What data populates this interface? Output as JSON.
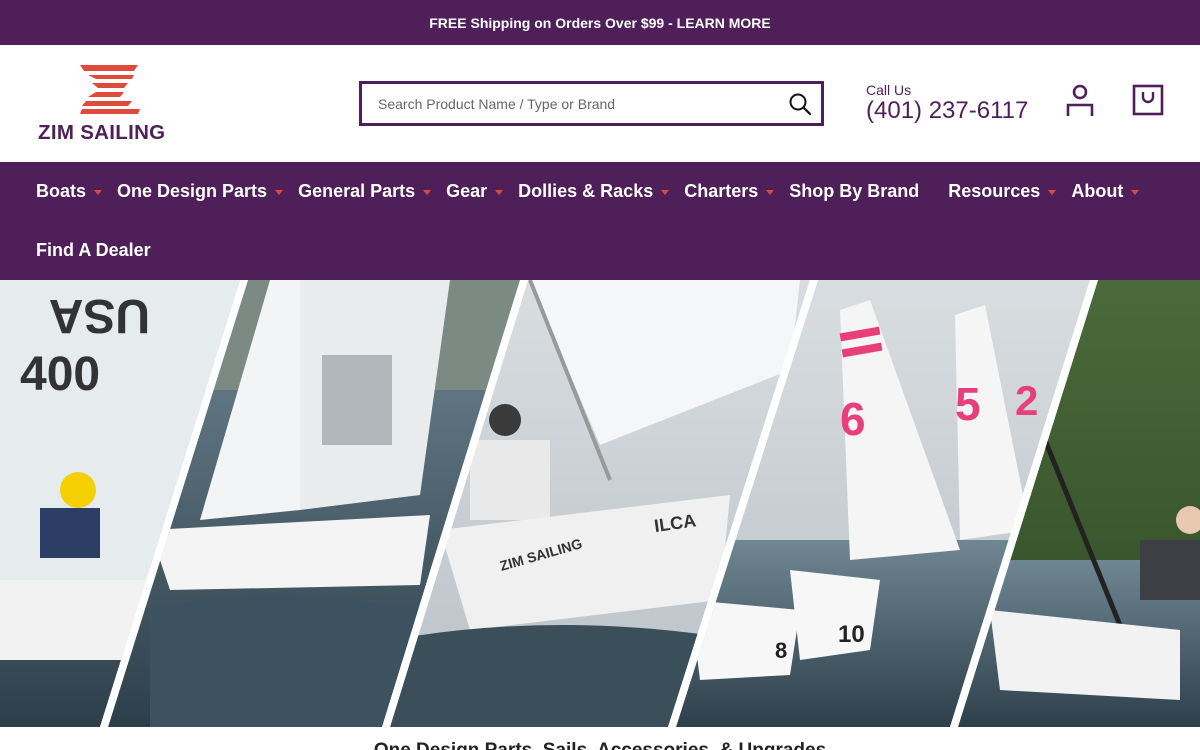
{
  "promo": {
    "text": "FREE Shipping on Orders Over $99 - LEARN MORE"
  },
  "header": {
    "logo_text": "ZIM SAILING",
    "search": {
      "placeholder": "Search Product Name / Type or Brand",
      "value": ""
    },
    "call_label": "Call Us",
    "phone": "(401) 237-6117"
  },
  "nav": {
    "row1": [
      {
        "label": "Boats",
        "has_dropdown": true
      },
      {
        "label": "One Design Parts",
        "has_dropdown": true
      },
      {
        "label": "General Parts",
        "has_dropdown": true
      },
      {
        "label": "Gear",
        "has_dropdown": true
      },
      {
        "label": "Dollies & Racks",
        "has_dropdown": true
      },
      {
        "label": "Charters",
        "has_dropdown": true
      },
      {
        "label": "Shop By Brand",
        "has_dropdown": false
      },
      {
        "label": "Resources",
        "has_dropdown": true
      },
      {
        "label": "About",
        "has_dropdown": true
      }
    ],
    "row2": [
      {
        "label": "Find A Dealer",
        "has_dropdown": false
      }
    ]
  },
  "hero": {
    "sail_numbers": [
      "USA",
      "400",
      "US",
      "400",
      "6",
      "5",
      "2",
      "10",
      "8"
    ],
    "hull_text": "ZIM SAILING",
    "class_text": "ILCA"
  },
  "section_title": "One Design Parts, Sails, Accessories, & Upgrades",
  "colors": {
    "brand_purple": "#4e1f58",
    "accent_red": "#e04a3b",
    "white": "#ffffff"
  }
}
